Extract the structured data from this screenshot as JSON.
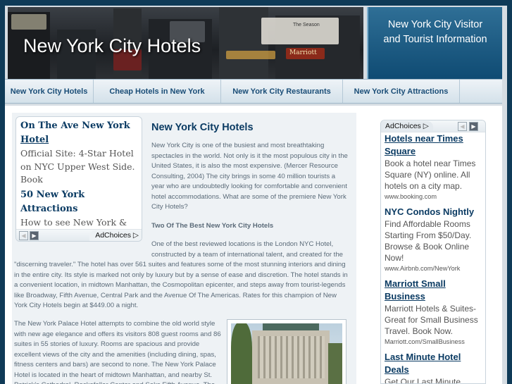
{
  "header": {
    "title": "New York City Hotels",
    "visitor_line1": "New York City Visitor",
    "visitor_line2": "and Tourist Information",
    "sign_text_1": "The Season",
    "sign_text_2": "Marriott"
  },
  "nav": [
    {
      "label": "New York City Hotels"
    },
    {
      "label": "Cheap Hotels in New York"
    },
    {
      "label": "New York City Restaurants"
    },
    {
      "label": "New York City Attractions"
    }
  ],
  "left_ad": {
    "ad1_title_line1": "On The Ave New York",
    "ad1_title_line2": "Hotel",
    "ad1_body": "Official Site: 4-Star Hotel on NYC Upper West Side. Book",
    "ad2_title": "50 New York Attractions",
    "ad2_body": "How to see New York & Save Money? Try New York Pass - Learn more",
    "adchoices": "AdChoices"
  },
  "article": {
    "title": "New York City Hotels",
    "intro": "New York City is one of the busiest and most breathtaking spectacles in the world. Not only is it the most populous city in the United States, it is also the most expensive. (Mercer Resource Consulting, 2004) The city brings in some 40 million tourists a year who are undoubtedly looking for comfortable and convenient hotel accommodations. What are some of the premiere New York City Hotels?",
    "subtitle": "Two Of The Best New York City Hotels",
    "para1_top": "One of the best reviewed locations is the London NYC Hotel, constructed by a team of international talent, and created for the",
    "para1_full": "\"discerning traveler.\" The hotel has over 561 suites and features some of the most stunning interiors and dining in the entire city. Its style is marked not only by luxury but by a sense of ease and discretion. The hotel stands in a convenient location, in midtown Manhattan, the Cosmopolitan epicenter, and steps away from tourist-legends like Broadway, Fifth Avenue, Central Park and the Avenue Of The Americas. Rates for this champion of New York City Hotels begin at $449.00 a night.",
    "para2": "The New York Palace Hotel attempts to combine the old world style with new age elegance and offers its visitors 808 guest rooms and 86 suites in 55 stories of luxury. Rooms are spacious and provide excellent views of the city and the amenities (including dining, spas, fitness centers and bars) are second to none. The New York Palace Hotel is located in the heart of midtown Manhattan, and nearby St. Patrick's Cathedral, Rockefeller Center and Saks Fifth Avenue. The"
  },
  "right_ads": {
    "adchoices": "AdChoices",
    "items": [
      {
        "title": "Hotels near Times Square",
        "desc": "Book a hotel near Times Square (NY) online. All hotels on a city map.",
        "url": "www.booking.com"
      },
      {
        "title": "NYC Condos Nightly",
        "desc": "Find Affordable Rooms Starting From $50/Day. Browse & Book Online Now!",
        "url": "www.Airbnb.com/NewYork"
      },
      {
        "title": "Marriott Small Business",
        "desc": "Marriott Hotels & Suites- Great for Small Business Travel. Book Now.",
        "url": "Marriott.com/SmallBusiness"
      },
      {
        "title": "Last Minute Hotel Deals",
        "desc": "Get Our Last Minute",
        "url": ""
      }
    ]
  },
  "colors": {
    "page_bg": "#0f3a57",
    "link_blue": "#0b3b63",
    "nav_text": "#1a4d77",
    "body_text": "#5a6a78"
  }
}
